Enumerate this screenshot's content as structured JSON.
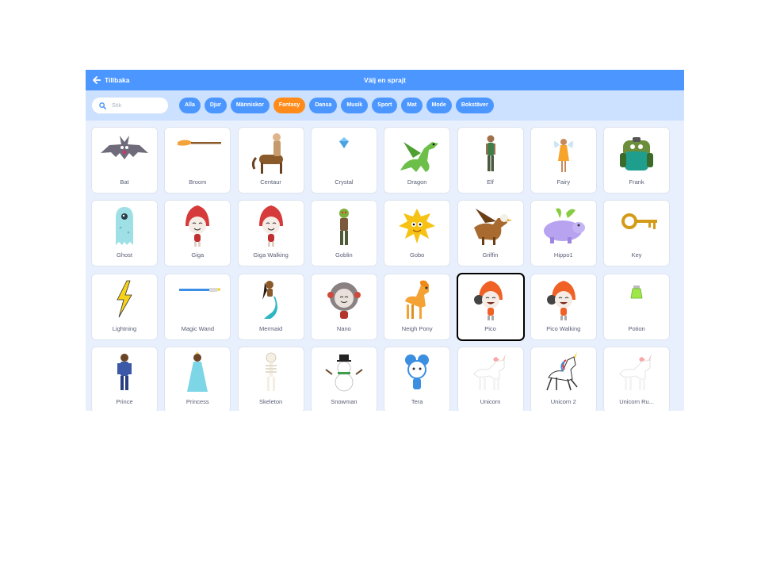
{
  "topbar": {
    "back_label": "Tillbaka",
    "title": "Välj en sprajt"
  },
  "search": {
    "placeholder": "Sök"
  },
  "tags": [
    {
      "label": "Alla",
      "active": false
    },
    {
      "label": "Djur",
      "active": false
    },
    {
      "label": "Människor",
      "active": false
    },
    {
      "label": "Fantasy",
      "active": true
    },
    {
      "label": "Dansa",
      "active": false
    },
    {
      "label": "Musik",
      "active": false
    },
    {
      "label": "Sport",
      "active": false
    },
    {
      "label": "Mat",
      "active": false
    },
    {
      "label": "Mode",
      "active": false
    },
    {
      "label": "Bokstäver",
      "active": false
    }
  ],
  "sprites": [
    {
      "name": "Bat",
      "icon": "bat"
    },
    {
      "name": "Broom",
      "icon": "broom"
    },
    {
      "name": "Centaur",
      "icon": "centaur"
    },
    {
      "name": "Crystal",
      "icon": "crystal"
    },
    {
      "name": "Dragon",
      "icon": "dragon"
    },
    {
      "name": "Elf",
      "icon": "elf"
    },
    {
      "name": "Fairy",
      "icon": "fairy"
    },
    {
      "name": "Frank",
      "icon": "frank"
    },
    {
      "name": "Ghost",
      "icon": "ghost"
    },
    {
      "name": "Giga",
      "icon": "giga"
    },
    {
      "name": "Giga Walking",
      "icon": "giga"
    },
    {
      "name": "Goblin",
      "icon": "goblin"
    },
    {
      "name": "Gobo",
      "icon": "gobo"
    },
    {
      "name": "Griffin",
      "icon": "griffin"
    },
    {
      "name": "Hippo1",
      "icon": "hippo"
    },
    {
      "name": "Key",
      "icon": "key"
    },
    {
      "name": "Lightning",
      "icon": "lightning"
    },
    {
      "name": "Magic Wand",
      "icon": "wand"
    },
    {
      "name": "Mermaid",
      "icon": "mermaid"
    },
    {
      "name": "Nano",
      "icon": "nano"
    },
    {
      "name": "Neigh Pony",
      "icon": "pony"
    },
    {
      "name": "Pico",
      "icon": "pico",
      "selected": true
    },
    {
      "name": "Pico Walking",
      "icon": "pico"
    },
    {
      "name": "Potion",
      "icon": "potion"
    },
    {
      "name": "Prince",
      "icon": "prince"
    },
    {
      "name": "Princess",
      "icon": "princess"
    },
    {
      "name": "Skeleton",
      "icon": "skeleton"
    },
    {
      "name": "Snowman",
      "icon": "snowman"
    },
    {
      "name": "Tera",
      "icon": "tera"
    },
    {
      "name": "Unicorn",
      "icon": "unicorn"
    },
    {
      "name": "Unicorn 2",
      "icon": "unicorn2"
    },
    {
      "name": "Unicorn Ru...",
      "icon": "unicorn"
    }
  ],
  "colors": {
    "header": "#4c97ff",
    "filterbar": "#cce0ff",
    "active_tag": "#ff8c1a",
    "background": "#e9f0fd"
  }
}
